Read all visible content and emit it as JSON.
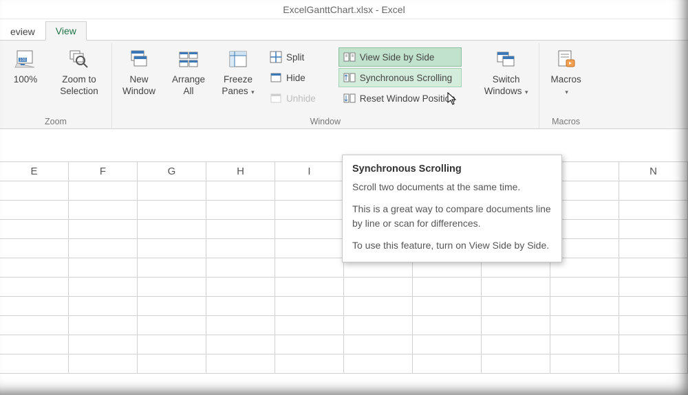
{
  "title": "ExcelGanttChart.xlsx - Excel",
  "tabs": {
    "review": "eview",
    "view": "View"
  },
  "ribbon": {
    "zoom": {
      "label": "Zoom",
      "hundred": "100%",
      "zoom_to_selection": "Zoom to Selection"
    },
    "window": {
      "label": "Window",
      "new_window": "New Window",
      "arrange_all": "Arrange All",
      "freeze_panes": "Freeze Panes",
      "split": "Split",
      "hide": "Hide",
      "unhide": "Unhide",
      "view_side_by_side": "View Side by Side",
      "synchronous_scrolling": "Synchronous Scrolling",
      "reset_window_position": "Reset Window Position",
      "switch_windows": "Switch Windows"
    },
    "macros": {
      "label": "Macros",
      "macros": "Macros"
    }
  },
  "columns": [
    "E",
    "F",
    "G",
    "H",
    "I",
    "",
    "",
    "",
    "",
    "N"
  ],
  "tooltip": {
    "title": "Synchronous Scrolling",
    "p1": "Scroll two documents at the same time.",
    "p2": "This is a great way to compare documents line by line or scan for differences.",
    "p3": "To use this feature, turn on View Side by Side."
  }
}
